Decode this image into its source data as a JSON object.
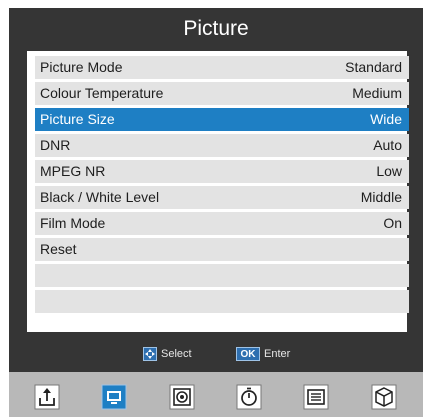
{
  "title": "Picture",
  "menu": {
    "items": [
      {
        "label": "Picture Mode",
        "value": "Standard"
      },
      {
        "label": "Colour Temperature",
        "value": "Medium"
      },
      {
        "label": "Picture Size",
        "value": "Wide"
      },
      {
        "label": "DNR",
        "value": "Auto"
      },
      {
        "label": "MPEG NR",
        "value": "Low"
      },
      {
        "label": "Black / White Level",
        "value": "Middle"
      },
      {
        "label": "Film Mode",
        "value": "On"
      },
      {
        "label": "Reset",
        "value": ""
      },
      {
        "label": "",
        "value": ""
      },
      {
        "label": "",
        "value": ""
      }
    ],
    "selected_index": 2
  },
  "hints": {
    "select_label": "Select",
    "ok_badge": "OK",
    "enter_label": "Enter"
  },
  "tabs": [
    {
      "icon": "source-icon"
    },
    {
      "icon": "picture-icon"
    },
    {
      "icon": "sound-icon"
    },
    {
      "icon": "timer-icon"
    },
    {
      "icon": "setup-icon"
    },
    {
      "icon": "lock-cube-icon"
    }
  ],
  "colors": {
    "background": "#353535",
    "highlight": "#1e7fc4",
    "row": "#e3e3e3",
    "bottom_bar": "#b8b8b8"
  }
}
